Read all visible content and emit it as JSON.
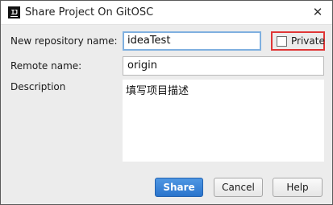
{
  "window": {
    "title": "Share Project On GitOSC",
    "icon": "intellij-icon",
    "icon_text": "IJ",
    "close_glyph": "✕"
  },
  "form": {
    "repo_name_label": "New repository name:",
    "repo_name_value": "ideaTest",
    "private_label": "Private",
    "private_checked": false,
    "remote_name_label": "Remote name:",
    "remote_name_value": "origin",
    "description_label": "Description",
    "description_value": "填写项目描述"
  },
  "buttons": {
    "share": "Share",
    "cancel": "Cancel",
    "help": "Help"
  },
  "colors": {
    "primary_button": "#2a74cc",
    "highlight_border": "#e03535",
    "focus_border": "#7fb0e0"
  }
}
